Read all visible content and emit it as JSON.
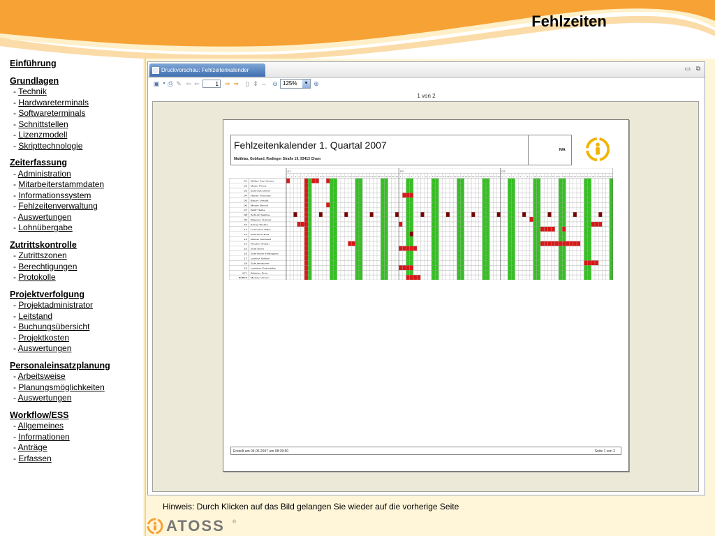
{
  "page": {
    "title": "Fehlzeiten",
    "hint": "Hinweis: Durch Klicken auf das Bild gelangen Sie wieder auf die vorherige Seite"
  },
  "nav": [
    {
      "label": "Einführung",
      "items": []
    },
    {
      "label": "Grundlagen",
      "items": [
        "Technik",
        "Hardwareterminals",
        "Softwareterminals",
        "Schnittstellen",
        "Lizenzmodell",
        "Skripttechnologie"
      ]
    },
    {
      "label": "Zeiterfassung",
      "items": [
        "Administration",
        "Mitarbeiterstammdaten",
        "Informationssystem",
        "Fehlzeitenverwaltung",
        "Auswertungen",
        "Lohnübergabe"
      ]
    },
    {
      "label": "Zutrittskontrolle",
      "items": [
        "Zutrittszonen",
        "Berechtigungen",
        "Protokolle"
      ]
    },
    {
      "label": "Projektverfolgung",
      "items": [
        "Projektadministrator",
        "Leitstand",
        "Buchungsübersicht",
        "Projektkosten",
        "Auswertungen"
      ]
    },
    {
      "label": "Personaleinsatzplanung",
      "items": [
        "Arbeitsweise",
        "Planungsmöglichkeiten",
        "Auswertungen"
      ]
    },
    {
      "label": "Workflow/ESS",
      "items": [
        "Allgemeines",
        "Informationen",
        "Anträge",
        "Erfassen"
      ]
    }
  ],
  "window": {
    "tab_label": "Druckvorschau: Fehlzeitenkalender Quartal",
    "page_value": "1",
    "zoom": "125%",
    "page_count": "1 von 2"
  },
  "report": {
    "title": "Fehlzeitenkalender 1. Quartal 2007",
    "subtitle": "Matthias, Gebhard, Rodinger Straße 19, 93413 Cham",
    "na": "N/A",
    "footer_left": "Erstellt am 04.05.2007 um 08:39:50",
    "footer_right": "Seite 1 von 2",
    "month_labels": [
      "01",
      "02",
      "03"
    ],
    "employees": [
      {
        "id": "01",
        "name": "Müller Karl-Heinz"
      },
      {
        "id": "02",
        "name": "Maier Petra"
      },
      {
        "id": "03",
        "name": "Schmidt Dieter"
      },
      {
        "id": "04",
        "name": "Huber Thomas"
      },
      {
        "id": "05",
        "name": "Bauer Ursula"
      },
      {
        "id": "06",
        "name": "Meyer Bernd"
      },
      {
        "id": "07",
        "name": "Wolf Heike"
      },
      {
        "id": "08",
        "name": "Schulz Sabine"
      },
      {
        "id": "09",
        "name": "Wagner Günter"
      },
      {
        "id": "10",
        "name": "König Stefan"
      },
      {
        "id": "11",
        "name": "Lehmann Silke"
      },
      {
        "id": "12",
        "name": "Schubert Eva"
      },
      {
        "id": "13",
        "name": "Weber Michael"
      },
      {
        "id": "14",
        "name": "Fischer Robin"
      },
      {
        "id": "15",
        "name": "Graf Erna"
      },
      {
        "id": "16",
        "name": "Schneider Hildegard"
      },
      {
        "id": "17",
        "name": "Lorenz Stefan"
      },
      {
        "id": "18",
        "name": "Schuhmacher"
      },
      {
        "id": "19",
        "name": "Lackner Franziska"
      },
      {
        "id": "471",
        "name": "Winkler Fritz"
      },
      {
        "id": "80815",
        "name": "Meister Armin"
      }
    ],
    "calendar": {
      "days_in_month": [
        31,
        28,
        31
      ],
      "first_weekday": 1,
      "holidays": [
        [
          1,
          6
        ]
      ],
      "absences": [
        {
          "row": 0,
          "month": 1,
          "day": 1,
          "type": "red"
        },
        {
          "row": 0,
          "month": 1,
          "day": 8,
          "type": "red"
        },
        {
          "row": 0,
          "month": 1,
          "day": 9,
          "type": "red"
        },
        {
          "row": 0,
          "month": 1,
          "day": 12,
          "type": "red"
        },
        {
          "row": 3,
          "month": 2,
          "day": 2,
          "type": "red"
        },
        {
          "row": 3,
          "month": 2,
          "day": 3,
          "type": "red"
        },
        {
          "row": 3,
          "month": 2,
          "day": 4,
          "type": "red"
        },
        {
          "row": 5,
          "month": 1,
          "day": 12,
          "type": "red"
        },
        {
          "row": 7,
          "month": 1,
          "day": 3,
          "type": "dark"
        },
        {
          "row": 7,
          "month": 1,
          "day": 10,
          "type": "dark"
        },
        {
          "row": 7,
          "month": 1,
          "day": 17,
          "type": "dark"
        },
        {
          "row": 7,
          "month": 1,
          "day": 24,
          "type": "dark"
        },
        {
          "row": 7,
          "month": 1,
          "day": 31,
          "type": "dark"
        },
        {
          "row": 7,
          "month": 2,
          "day": 7,
          "type": "dark"
        },
        {
          "row": 7,
          "month": 2,
          "day": 14,
          "type": "dark"
        },
        {
          "row": 7,
          "month": 2,
          "day": 21,
          "type": "dark"
        },
        {
          "row": 7,
          "month": 2,
          "day": 28,
          "type": "dark"
        },
        {
          "row": 7,
          "month": 3,
          "day": 7,
          "type": "dark"
        },
        {
          "row": 7,
          "month": 3,
          "day": 14,
          "type": "dark"
        },
        {
          "row": 7,
          "month": 3,
          "day": 21,
          "type": "dark"
        },
        {
          "row": 7,
          "month": 3,
          "day": 28,
          "type": "dark"
        },
        {
          "row": 8,
          "month": 3,
          "day": 9,
          "type": "red"
        },
        {
          "row": 9,
          "month": 1,
          "day": 4,
          "type": "red"
        },
        {
          "row": 9,
          "month": 1,
          "day": 5,
          "type": "red"
        },
        {
          "row": 9,
          "month": 1,
          "day": 6,
          "type": "red"
        },
        {
          "row": 9,
          "month": 2,
          "day": 1,
          "type": "red"
        },
        {
          "row": 9,
          "month": 3,
          "day": 26,
          "type": "red"
        },
        {
          "row": 9,
          "month": 3,
          "day": 27,
          "type": "red"
        },
        {
          "row": 9,
          "month": 3,
          "day": 28,
          "type": "red"
        },
        {
          "row": 10,
          "month": 3,
          "day": 12,
          "type": "red"
        },
        {
          "row": 10,
          "month": 3,
          "day": 13,
          "type": "red"
        },
        {
          "row": 10,
          "month": 3,
          "day": 14,
          "type": "red"
        },
        {
          "row": 10,
          "month": 3,
          "day": 15,
          "type": "red"
        },
        {
          "row": 10,
          "month": 3,
          "day": 18,
          "type": "red"
        },
        {
          "row": 11,
          "month": 2,
          "day": 4,
          "type": "dark"
        },
        {
          "row": 13,
          "month": 1,
          "day": 18,
          "type": "red"
        },
        {
          "row": 13,
          "month": 1,
          "day": 19,
          "type": "red"
        },
        {
          "row": 13,
          "month": 3,
          "day": 12,
          "type": "red"
        },
        {
          "row": 13,
          "month": 3,
          "day": 13,
          "type": "red"
        },
        {
          "row": 13,
          "month": 3,
          "day": 14,
          "type": "red"
        },
        {
          "row": 13,
          "month": 3,
          "day": 15,
          "type": "red"
        },
        {
          "row": 13,
          "month": 3,
          "day": 16,
          "type": "red"
        },
        {
          "row": 13,
          "month": 3,
          "day": 17,
          "type": "red"
        },
        {
          "row": 13,
          "month": 3,
          "day": 18,
          "type": "red"
        },
        {
          "row": 13,
          "month": 3,
          "day": 19,
          "type": "red"
        },
        {
          "row": 13,
          "month": 3,
          "day": 20,
          "type": "red"
        },
        {
          "row": 13,
          "month": 3,
          "day": 21,
          "type": "red"
        },
        {
          "row": 13,
          "month": 3,
          "day": 22,
          "type": "red"
        },
        {
          "row": 14,
          "month": 2,
          "day": 1,
          "type": "red"
        },
        {
          "row": 14,
          "month": 2,
          "day": 2,
          "type": "red"
        },
        {
          "row": 14,
          "month": 2,
          "day": 3,
          "type": "red"
        },
        {
          "row": 14,
          "month": 2,
          "day": 4,
          "type": "red"
        },
        {
          "row": 14,
          "month": 2,
          "day": 5,
          "type": "red"
        },
        {
          "row": 17,
          "month": 3,
          "day": 24,
          "type": "red"
        },
        {
          "row": 17,
          "month": 3,
          "day": 25,
          "type": "red"
        },
        {
          "row": 17,
          "month": 3,
          "day": 26,
          "type": "red"
        },
        {
          "row": 17,
          "month": 3,
          "day": 27,
          "type": "red"
        },
        {
          "row": 18,
          "month": 2,
          "day": 1,
          "type": "red"
        },
        {
          "row": 18,
          "month": 2,
          "day": 2,
          "type": "red"
        },
        {
          "row": 18,
          "month": 2,
          "day": 3,
          "type": "red"
        },
        {
          "row": 18,
          "month": 2,
          "day": 4,
          "type": "red"
        },
        {
          "row": 20,
          "month": 2,
          "day": 3,
          "type": "red"
        },
        {
          "row": 20,
          "month": 2,
          "day": 4,
          "type": "red"
        },
        {
          "row": 20,
          "month": 2,
          "day": 5,
          "type": "red"
        },
        {
          "row": 20,
          "month": 2,
          "day": 6,
          "type": "red"
        }
      ]
    }
  },
  "brand": {
    "name": "ATOSS",
    "mark": "®"
  },
  "colors": {
    "accent_orange": "#f7a234",
    "weekend_green": "#34c021",
    "absence_red": "#d81818",
    "absence_dark": "#7a0000",
    "viewport_bg": "#ece9d8"
  }
}
